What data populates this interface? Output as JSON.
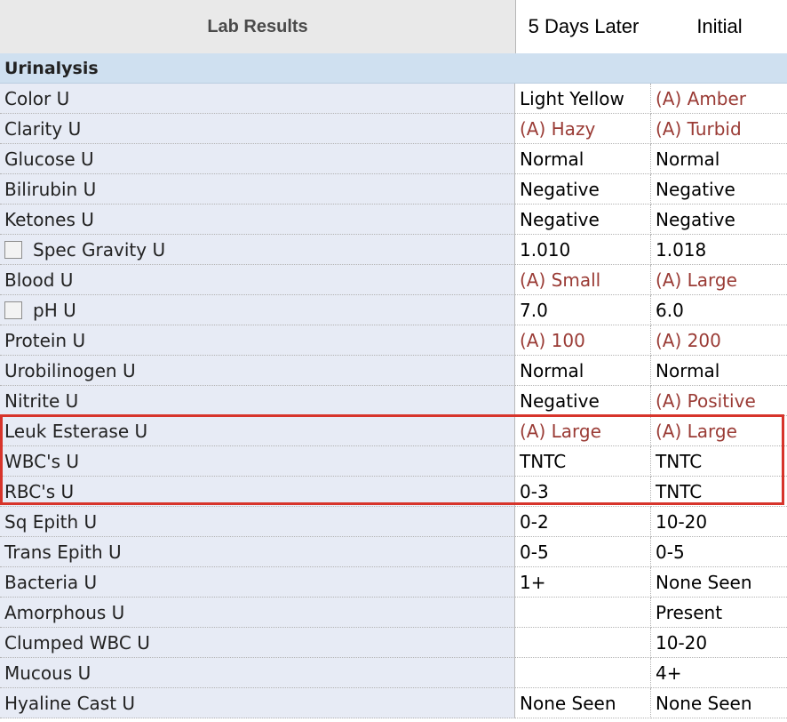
{
  "header": {
    "title": "Lab Results",
    "col1": "5 Days Later",
    "col2": "Initial"
  },
  "section": {
    "title": "Urinalysis"
  },
  "rows": [
    {
      "label": "Color U",
      "v1": "Light Yellow",
      "v2": "(A) Amber"
    },
    {
      "label": "Clarity U",
      "v1": "(A) Hazy",
      "v2": "(A) Turbid"
    },
    {
      "label": "Glucose U",
      "v1": "Normal",
      "v2": "Normal"
    },
    {
      "label": "Bilirubin U",
      "v1": "Negative",
      "v2": "Negative"
    },
    {
      "label": "Ketones U",
      "v1": "Negative",
      "v2": "Negative"
    },
    {
      "label": "Spec Gravity U",
      "v1": "1.010",
      "v2": "1.018"
    },
    {
      "label": "Blood U",
      "v1": "(A) Small",
      "v2": "(A) Large"
    },
    {
      "label": "pH U",
      "v1": "7.0",
      "v2": "6.0"
    },
    {
      "label": "Protein U",
      "v1": "(A) 100",
      "v2": "(A) 200"
    },
    {
      "label": "Urobilinogen U",
      "v1": "Normal",
      "v2": "Normal"
    },
    {
      "label": "Nitrite U",
      "v1": "Negative",
      "v2": "(A) Positive"
    },
    {
      "label": "Leuk Esterase U",
      "v1": "(A) Large",
      "v2": "(A) Large"
    },
    {
      "label": "WBC's U",
      "v1": "TNTC",
      "v2": "TNTC"
    },
    {
      "label": "RBC's U",
      "v1": "0-3",
      "v2": "TNTC"
    },
    {
      "label": "Sq Epith U",
      "v1": "0-2",
      "v2": "10-20"
    },
    {
      "label": "Trans Epith U",
      "v1": "0-5",
      "v2": "0-5"
    },
    {
      "label": "Bacteria U",
      "v1": "1+",
      "v2": "None Seen"
    },
    {
      "label": "Amorphous U",
      "v1": "",
      "v2": "Present"
    },
    {
      "label": "Clumped WBC U",
      "v1": "",
      "v2": "10-20"
    },
    {
      "label": "Mucous U",
      "v1": "",
      "v2": "4+"
    },
    {
      "label": "Hyaline Cast U",
      "v1": "None Seen",
      "v2": "None Seen"
    }
  ],
  "colors": {
    "abnormal_text": "#9a3b35",
    "highlight_border": "#d7342b",
    "section_bg": "#cfe0f0",
    "label_bg": "#e7ebf5"
  }
}
